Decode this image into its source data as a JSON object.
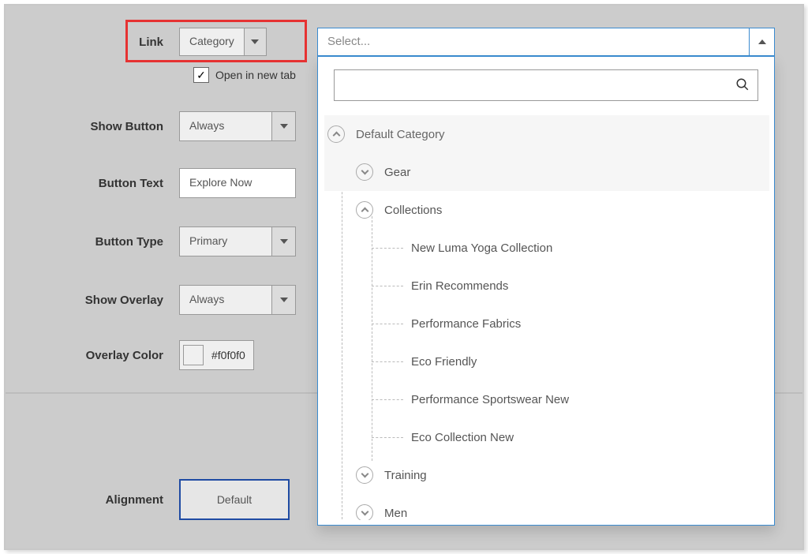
{
  "form": {
    "link": {
      "label": "Link",
      "type_value": "Category",
      "select_placeholder": "Select...",
      "open_new_tab_label": "Open in new tab",
      "open_new_tab_checked": true
    },
    "show_button": {
      "label": "Show Button",
      "value": "Always"
    },
    "button_text": {
      "label": "Button Text",
      "value": "Explore Now"
    },
    "button_type": {
      "label": "Button Type",
      "value": "Primary"
    },
    "show_overlay": {
      "label": "Show Overlay",
      "value": "Always"
    },
    "overlay_color": {
      "label": "Overlay Color",
      "value": "#f0f0f0",
      "swatch": "#f0f0f0"
    },
    "alignment": {
      "label": "Alignment",
      "value": "Default"
    }
  },
  "category_tree": {
    "root": "Default Category",
    "items": [
      {
        "label": "Gear",
        "level": 1,
        "expandable": true,
        "expanded": false,
        "hover": true
      },
      {
        "label": "Collections",
        "level": 1,
        "expandable": true,
        "expanded": true
      },
      {
        "label": "New Luma Yoga Collection",
        "level": 2
      },
      {
        "label": "Erin Recommends",
        "level": 2
      },
      {
        "label": "Performance Fabrics",
        "level": 2
      },
      {
        "label": "Eco Friendly",
        "level": 2
      },
      {
        "label": "Performance Sportswear New",
        "level": 2
      },
      {
        "label": "Eco Collection New",
        "level": 2
      },
      {
        "label": "Training",
        "level": 1,
        "expandable": true,
        "expanded": false
      },
      {
        "label": "Men",
        "level": 1,
        "expandable": true,
        "expanded": false
      }
    ]
  }
}
